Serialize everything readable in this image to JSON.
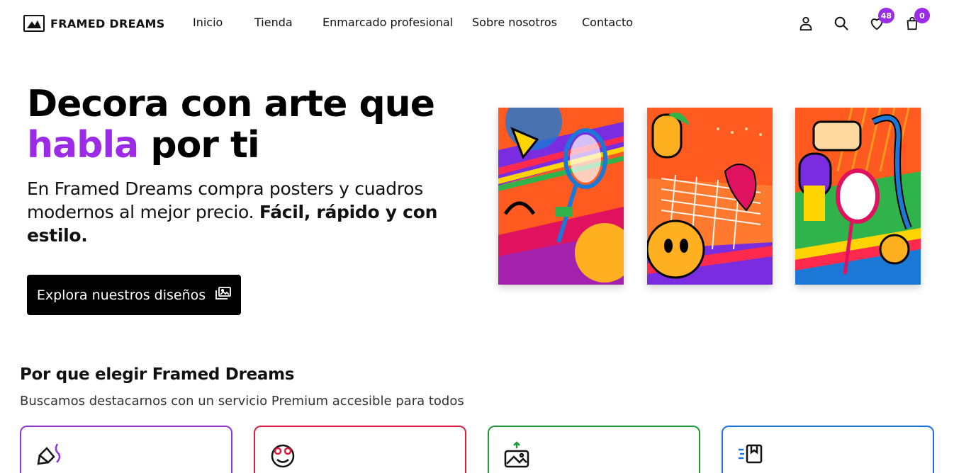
{
  "header": {
    "brand": "FRAMED DREAMS",
    "nav": [
      "Inicio",
      "Tienda",
      "Enmarcado profesional",
      "Sobre nosotros",
      "Contacto"
    ],
    "wishlist_count": "48",
    "cart_count": "0"
  },
  "hero": {
    "title_line1": "Decora con arte que",
    "title_accent": "habla",
    "title_rest": " por ti",
    "subtitle_normal": "En Framed Dreams compra posters y cuadros modernos al mejor precio. ",
    "subtitle_bold": "Fácil, rápido y con estilo.",
    "cta_label": "Explora nuestros diseños"
  },
  "why": {
    "title": "Por que elegir Framed Dreams",
    "subtitle": "Buscamos destacarnos con un servicio Premium accesible para todos",
    "cards": [
      {
        "icon": "brush-icon",
        "color": "#8e36d6"
      },
      {
        "icon": "star-eyes-face-icon",
        "color": "#e01d3d"
      },
      {
        "icon": "image-upload-icon",
        "color": "#1e9a3b"
      },
      {
        "icon": "fast-frame-icon",
        "color": "#1a73d9"
      }
    ]
  },
  "colors": {
    "accent": "#9b2be6",
    "cta_bg": "#000000"
  }
}
